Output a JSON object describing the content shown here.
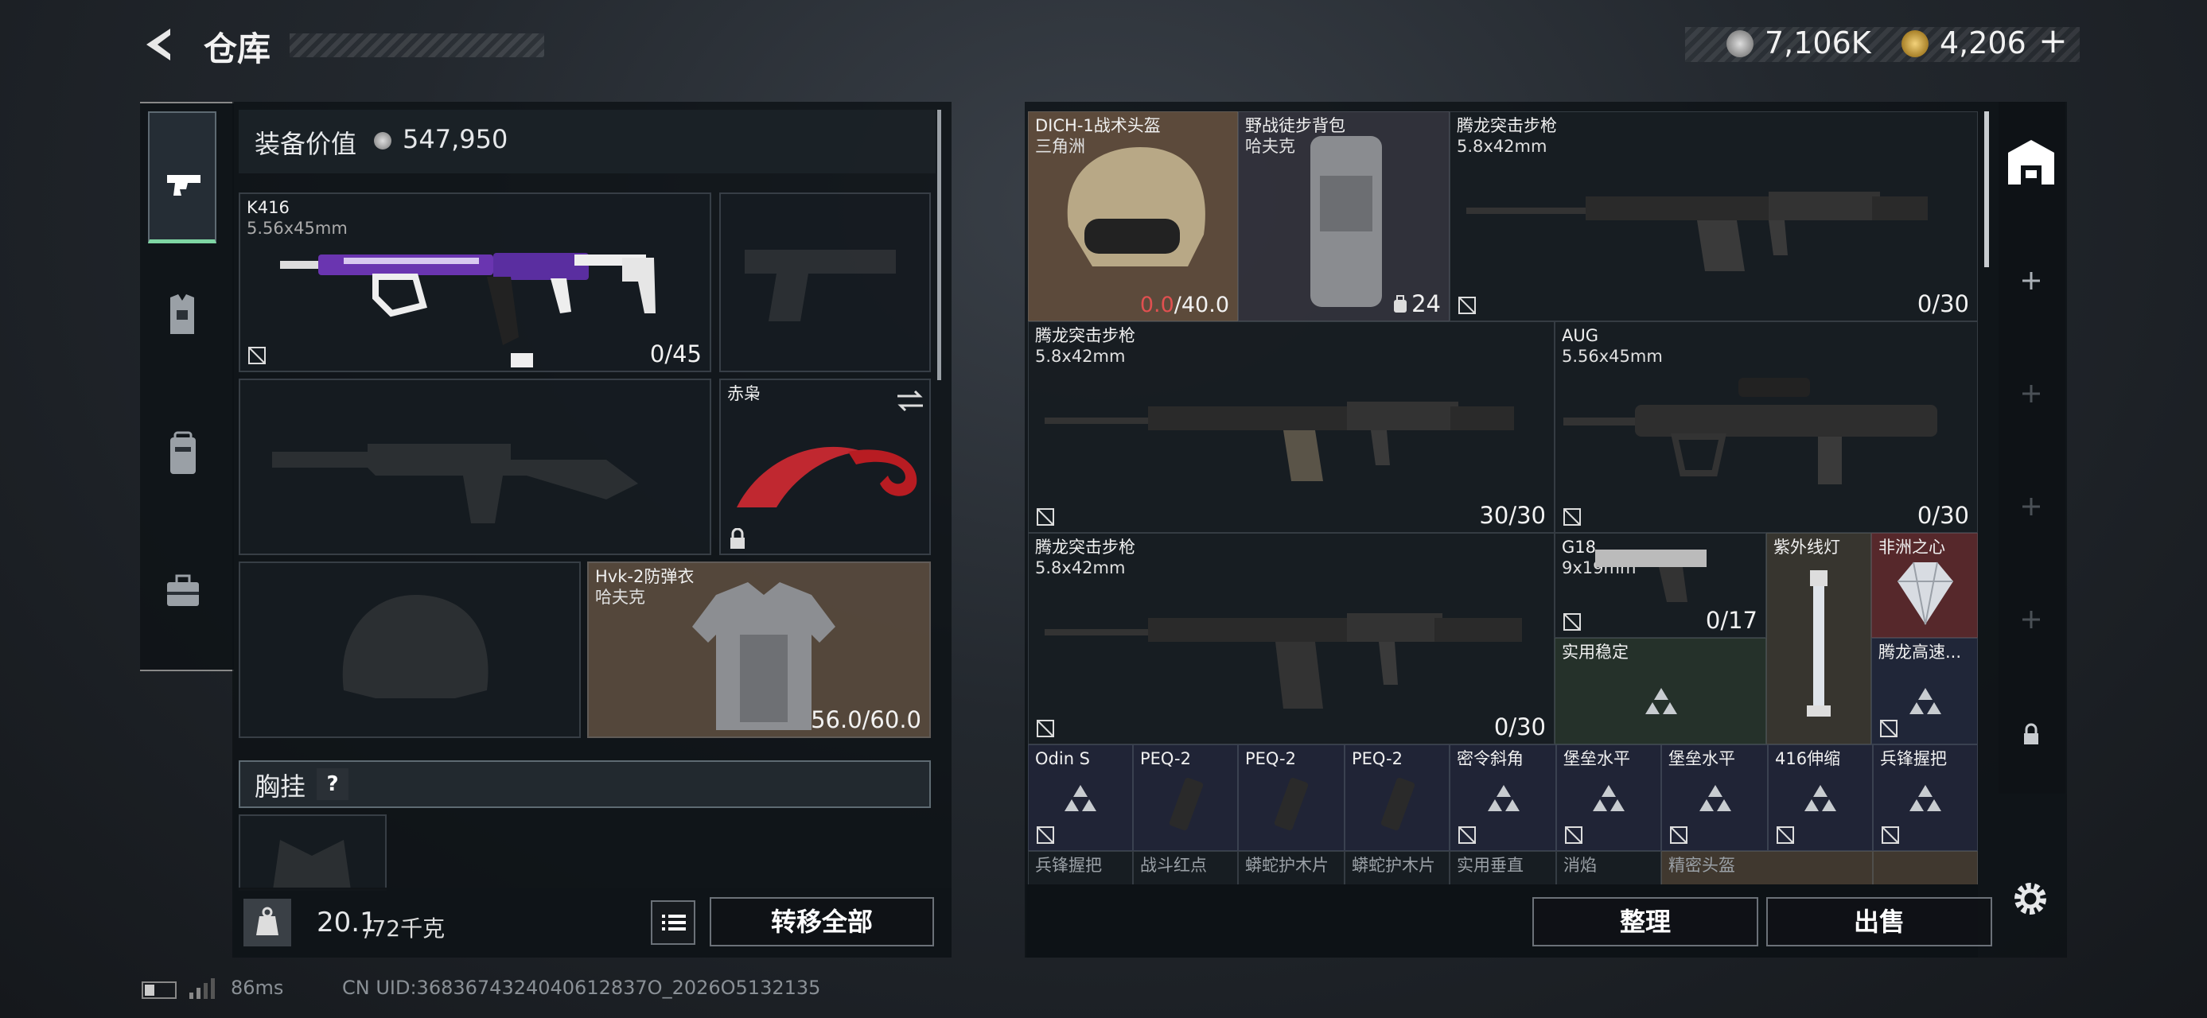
{
  "header": {
    "title": "仓库",
    "currency1": "7,106K",
    "currency2": "4,206",
    "plus": "+"
  },
  "left": {
    "gear_value_label": "装备价值",
    "gear_value": "547,950",
    "primary_weapon": {
      "name": "K416",
      "caliber": "5.56x45mm",
      "ammo": "0/45"
    },
    "melee": {
      "name": "赤枭"
    },
    "armor": {
      "name": "Hvk-2防弹衣",
      "maker": "哈夫克",
      "durability": "56.0/60.0"
    },
    "chest_rig_label": "胸挂",
    "help": "?",
    "weight": "20.1",
    "weight_max": "/72千克",
    "kg": "KG",
    "transfer_all": "转移全部"
  },
  "stash": {
    "helmet": {
      "name": "DICH-1战术头盔",
      "maker": "三角洲",
      "durability_current": "0.0",
      "durability_max": "/40.0"
    },
    "backpack": {
      "name": "野战徒步背包",
      "maker": "哈夫克",
      "capacity": "24"
    },
    "rifle1": {
      "name": "腾龙突击步枪",
      "caliber": "5.8x42mm",
      "ammo": "0/30"
    },
    "rifle2": {
      "name": "腾龙突击步枪",
      "caliber": "5.8x42mm",
      "ammo": "30/30"
    },
    "aug": {
      "name": "AUG",
      "caliber": "5.56x45mm",
      "ammo": "0/30"
    },
    "rifle3": {
      "name": "腾龙突击步枪",
      "caliber": "5.8x42mm",
      "ammo": "0/30"
    },
    "g18": {
      "name": "G18",
      "caliber": "9x19mm",
      "ammo": "0/17"
    },
    "uv_light": {
      "name": "紫外线灯"
    },
    "africa_heart": {
      "name": "非洲之心"
    },
    "stock_practical": {
      "name": "实用稳定"
    },
    "tenglong_fast": {
      "name": "腾龙高速..."
    },
    "row": [
      {
        "name": "Odin S"
      },
      {
        "name": "PEQ-2"
      },
      {
        "name": "PEQ-2"
      },
      {
        "name": "PEQ-2"
      },
      {
        "name": "密令斜角"
      },
      {
        "name": "堡垒水平"
      },
      {
        "name": "堡垒水平"
      },
      {
        "name": "416伸缩"
      },
      {
        "name": "兵锋握把"
      }
    ],
    "partial": [
      "兵锋握把",
      "战斗红点",
      "蟒蛇护木片",
      "蟒蛇护木片",
      "实用垂直",
      "消焰",
      "精密头盔"
    ],
    "sort_button": "整理",
    "sell_button": "出售"
  },
  "status": {
    "ping": "86ms",
    "uid": "CN UID:3683674324040612837O_2026O5132135"
  },
  "colors": {
    "accent_green": "#7fd6a4",
    "damage_red": "#e05050"
  }
}
